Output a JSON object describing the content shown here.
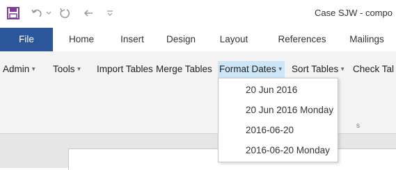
{
  "title_bar": {
    "doc_title": "Case SJW - compo",
    "quick_access": [
      "save-icon",
      "undo-icon",
      "undo-dropdown-icon",
      "redo-icon",
      "back-arrow-icon",
      "customize-qat-icon"
    ]
  },
  "ribbon_tabs": [
    "File",
    "Home",
    "Insert",
    "Design",
    "Layout",
    "References",
    "Mailings"
  ],
  "toolbar": {
    "admin": "Admin",
    "tools": "Tools",
    "import_tables": "Import Tables",
    "merge_tables": "Merge Tables",
    "format_dates": "Format Dates",
    "sort_tables": "Sort Tables",
    "check_tables": "Check Tal"
  },
  "ribbon_group_fragment": "s",
  "format_dates_menu": [
    "20 Jun 2016",
    "20 Jun 2016 Monday",
    "2016-06-20",
    "2016-06-20 Monday"
  ],
  "colors": {
    "file_tab": "#2b579a",
    "save_icon": "#7b3f98",
    "active_menu_highlight": "#cde6f7",
    "ribbon_bg": "#f3f3f3"
  }
}
